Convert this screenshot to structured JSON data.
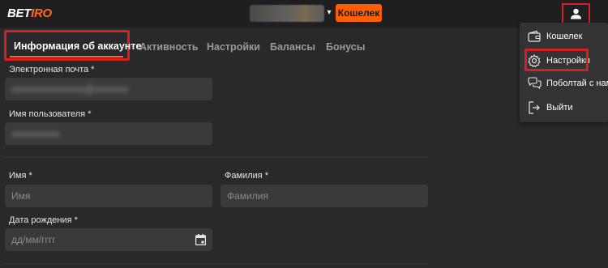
{
  "header": {
    "logo_main": "BET",
    "logo_accent": "IRO",
    "wallet_button": "Кошелек",
    "balance_chevron": "▾"
  },
  "tabs": [
    {
      "label": "Информация об аккаунте",
      "active": true
    },
    {
      "label": "Активность",
      "active": false
    },
    {
      "label": "Настройки",
      "active": false
    },
    {
      "label": "Балансы",
      "active": false
    },
    {
      "label": "Бонусы",
      "active": false
    }
  ],
  "form": {
    "email_label": "Электронная почта",
    "email_value": "xxxxxxxxxxxxxxx@xxxxxxx",
    "username_label": "Имя пользователя",
    "username_value": "xxxxxxxxxx",
    "first_name_label": "Имя",
    "first_name_placeholder": "Имя",
    "last_name_label": "Фамилия",
    "last_name_placeholder": "Фамилия",
    "dob_label": "Дата рождения",
    "dob_placeholder": "дд/мм/гггг",
    "required_mark": "*"
  },
  "user_menu": {
    "items": [
      {
        "label": "Кошелек",
        "icon": "wallet-icon"
      },
      {
        "label": "Настройки",
        "icon": "gear-icon"
      },
      {
        "label": "Поболтай с нами",
        "icon": "chat-icon"
      },
      {
        "label": "Выйти",
        "icon": "logout-icon"
      }
    ]
  },
  "colors": {
    "accent": "#ff5f00",
    "highlight": "#d8201e",
    "background": "#29292b",
    "header": "#1f1f21"
  }
}
